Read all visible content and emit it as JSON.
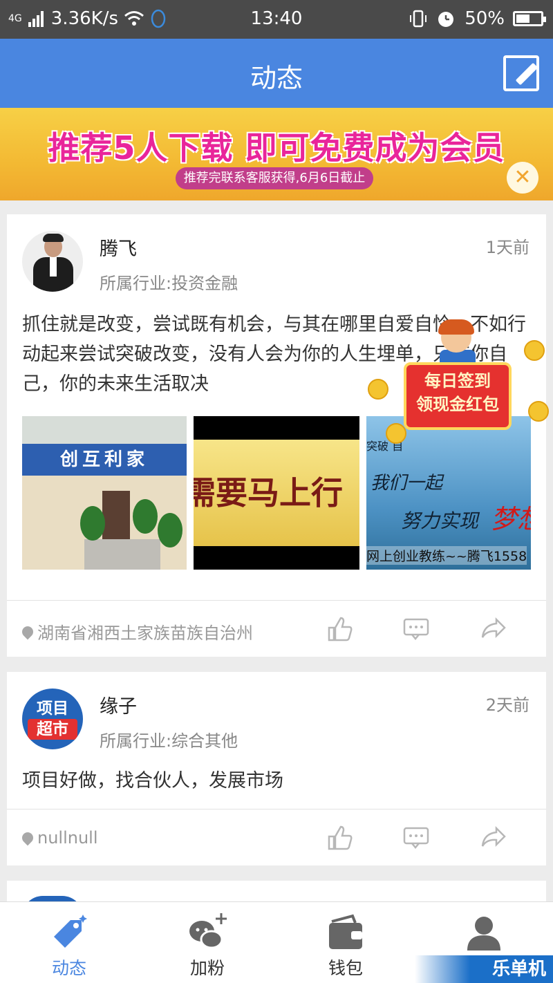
{
  "status_bar": {
    "network": "4G",
    "speed": "3.36K/s",
    "time": "13:40",
    "battery": "50%"
  },
  "nav": {
    "title": "动态",
    "edit_icon": "edit-icon"
  },
  "banner": {
    "title": "推荐5人下载 即可免费成为会员",
    "subtitle": "推荐完联系客服获得,6月6日截止",
    "close_symbol": "✕"
  },
  "float_ad": {
    "line1": "每日签到",
    "line2": "领现金红包"
  },
  "posts": [
    {
      "user": "腾飞",
      "time": "1天前",
      "industry": "所属行业:投资金融",
      "text": "抓住就是改变，尝试既有机会，与其在哪里自爱自怜，不如行动起来尝试突破改变，没有人会为你的人生埋单，只有你自己，你的未来生活取决",
      "photos": {
        "p1_sign": "创互利家",
        "p2_text": "需要马上行",
        "p3_top": "突破 自",
        "p3_line1": "我们一起",
        "p3_line2": "努力实现",
        "p3_red": "梦想",
        "p3_caption": "网上创业教练~~腾飞1558"
      },
      "location": "湖南省湘西土家族苗族自治州"
    },
    {
      "user": "缘子",
      "time": "2天前",
      "industry": "所属行业:综合其他",
      "avatar_line1": "项目",
      "avatar_line2": "超市",
      "text": "项目好做，找合伙人，发展市场",
      "location": "nullnull"
    }
  ],
  "tabs": [
    {
      "label": "动态",
      "icon": "tag-icon"
    },
    {
      "label": "加粉",
      "icon": "wechat-add-icon"
    },
    {
      "label": "钱包",
      "icon": "wallet-icon"
    },
    {
      "label": "",
      "icon": "person-icon"
    }
  ],
  "watermark": "乐单机",
  "colors": {
    "accent": "#4a86e0",
    "banner_pink": "#e9259a",
    "status_bar": "#4a4a4a"
  }
}
